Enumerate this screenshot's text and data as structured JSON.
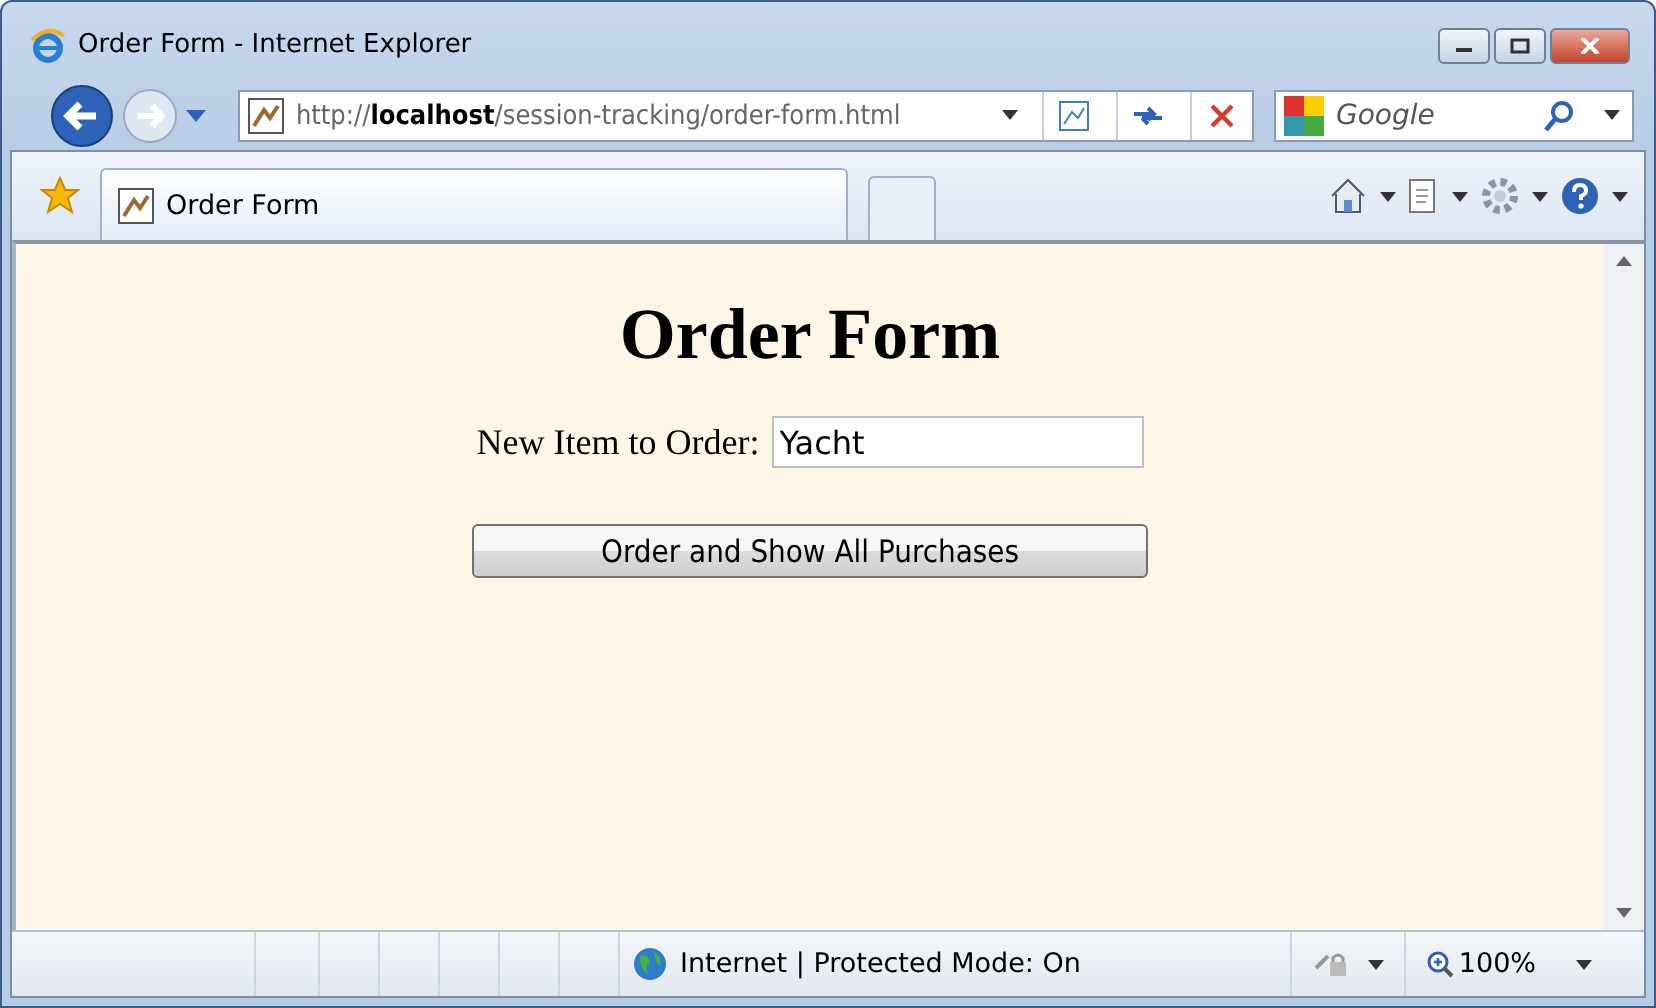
{
  "window": {
    "title": "Order Form - Internet Explorer"
  },
  "address_bar": {
    "url": "http://**localhost**/session-tracking/order-form.html"
  },
  "search": {
    "placeholder": "Google"
  },
  "tabs": [
    {
      "label": "Order Form",
      "selected": true
    }
  ],
  "page": {
    "heading": "Order Form",
    "field_label": "New Item to Order:",
    "field_value": "Yacht",
    "button": "Order and Show All Purchases"
  },
  "status_bar": {
    "zone": "Internet | Protected Mode: On",
    "zoom": "100%"
  }
}
